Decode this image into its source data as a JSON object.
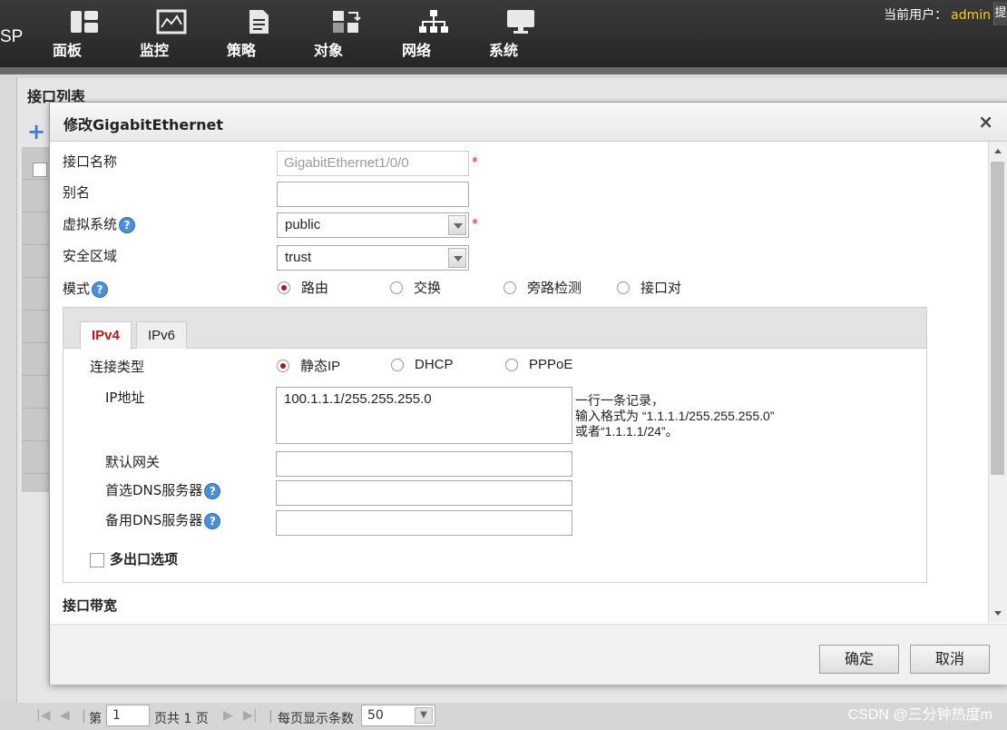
{
  "app": {
    "brand": "SP"
  },
  "nav": [
    {
      "label": "面板",
      "icon": "dashboard-icon"
    },
    {
      "label": "监控",
      "icon": "monitor-chart-icon"
    },
    {
      "label": "策略",
      "icon": "policy-document-icon"
    },
    {
      "label": "对象",
      "icon": "objects-icon"
    },
    {
      "label": "网络",
      "icon": "network-icon"
    },
    {
      "label": "系统",
      "icon": "system-display-icon"
    }
  ],
  "user": {
    "label": "当前用户：",
    "name": "admin",
    "extra_btn": "提"
  },
  "list": {
    "title": "接口列表",
    "add_icon": "+"
  },
  "dialog": {
    "title": "修改GigabitEthernet",
    "close": "×",
    "fields": {
      "if_name_label": "接口名称",
      "if_name_value": "GigabitEthernet1/0/0",
      "alias_label": "别名",
      "alias_value": "",
      "vsys_label": "虚拟系统",
      "vsys_value": "public",
      "zone_label": "安全区域",
      "zone_value": "trust",
      "mode_label": "模式",
      "required_mark": "*",
      "help_mark": "?"
    },
    "modes": [
      "路由",
      "交换",
      "旁路检测",
      "接口对"
    ],
    "selected_mode": "路由",
    "tabs": [
      "IPv4",
      "IPv6"
    ],
    "active_tab": "IPv4",
    "ipv4": {
      "conn_type_label": "连接类型",
      "conn_types": [
        "静态IP",
        "DHCP",
        "PPPoE"
      ],
      "selected_conn": "静态IP",
      "ip_label": "IP地址",
      "ip_value": "100.1.1.1/255.255.255.0",
      "ip_hint_1": "一行一条记录，",
      "ip_hint_2": "输入格式为 “1.1.1.1/255.255.255.0”",
      "ip_hint_3": "或者“1.1.1.1/24”。",
      "gateway_label": "默认网关",
      "gateway_value": "",
      "dns1_label": "首选DNS服务器",
      "dns1_value": "",
      "dns2_label": "备用DNS服务器",
      "dns2_value": "",
      "multi_exit_label": "多出口选项"
    },
    "bandwidth_label": "接口带宽",
    "buttons": {
      "ok": "确定",
      "cancel": "取消"
    }
  },
  "pager": {
    "page_prefix": "第",
    "page_value": "1",
    "page_suffix": "页共 1 页",
    "per_page_label": "每页显示条数",
    "per_page_value": "50"
  },
  "watermark": "CSDN @三分钟热度m"
}
